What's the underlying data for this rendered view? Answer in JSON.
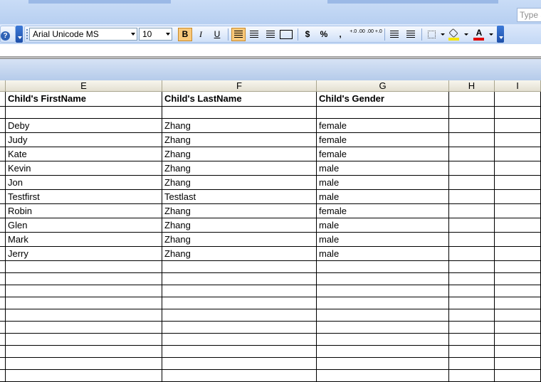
{
  "help_box": {
    "placeholder": "Type a"
  },
  "toolbar": {
    "help_glyph": "?",
    "font_name": "Arial Unicode MS",
    "font_size": "10",
    "bold_label": "B",
    "italic_label": "I",
    "underline_label": "U",
    "currency_label": "$",
    "percent_label": "%",
    "comma_label": ",",
    "increase_decimal_label": "+.0 .00",
    "decrease_decimal_label": ".00 +.0",
    "fill_color": "#f5e500",
    "font_color": "#e00000",
    "font_color_label": "A"
  },
  "columns": [
    "E",
    "F",
    "G",
    "H",
    "I"
  ],
  "sheet": {
    "header": [
      "Child's FirstName",
      "Child's LastName",
      "Child's Gender"
    ],
    "rows": [
      [
        "Deby",
        "Zhang",
        "female"
      ],
      [
        "Judy",
        "Zhang",
        "female"
      ],
      [
        "Kate",
        "Zhang",
        "female"
      ],
      [
        "Kevin",
        "Zhang",
        "male"
      ],
      [
        "Jon",
        "Zhang",
        "male"
      ],
      [
        "Testfirst",
        "Testlast",
        "male"
      ],
      [
        "Robin",
        "Zhang",
        "female"
      ],
      [
        "Glen",
        "Zhang",
        "male"
      ],
      [
        "Mark",
        "Zhang",
        "male"
      ],
      [
        "Jerry",
        "Zhang",
        "male"
      ]
    ]
  }
}
